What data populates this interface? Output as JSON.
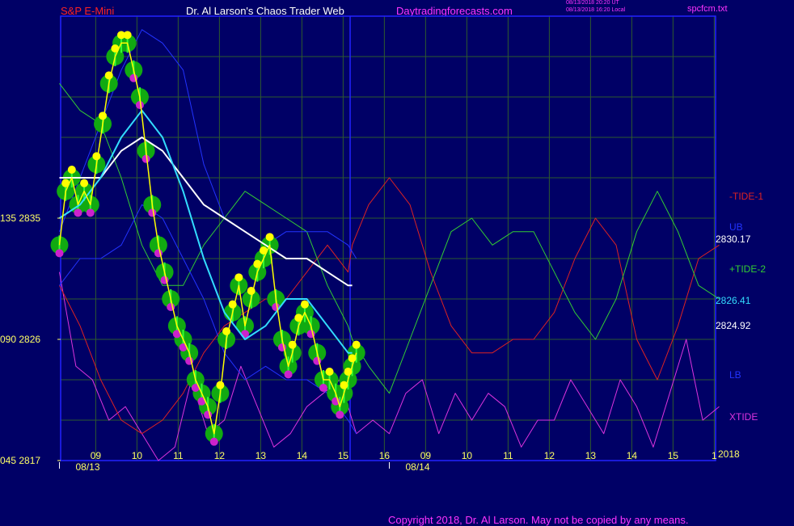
{
  "header": {
    "title": "S&P E-Mini",
    "web": "Dr. Al Larson's Chaos Trader Web",
    "url": "Daytradingforecasts.com",
    "timestamp_utc": "08/13/2018 20:20 UT",
    "timestamp_local": "08/13/2018 16:20 Local",
    "file": "spcfcm.txt"
  },
  "footer": {
    "copyright": "Copyright 2018, Dr. Al Larson. May not be copied by any means."
  },
  "colors": {
    "background": "#000066",
    "grid": "#2d5a2d",
    "frame": "#2222ff",
    "title": "#ff2222",
    "web": "#ffffff",
    "url": "#ff33ff",
    "tide1": "#dd2222",
    "tide2": "#33cc33",
    "xtide": "#dd33dd",
    "ub": "#2233ff",
    "lb": "#2233ff",
    "price": "#ffff00",
    "ma_fast": "#33ddff",
    "ma_slow": "#ffffff",
    "dot_yellow": "#ffff00",
    "dot_magenta": "#cc22cc",
    "halo": "#11aa11",
    "bars": "#33ff33"
  },
  "chart_data": {
    "type": "line",
    "title": "S&P E-Mini",
    "y_axis": {
      "ticks": [
        {
          "label": "135  2835",
          "value": 2835
        },
        {
          "label": "090  2826",
          "value": 2826
        },
        {
          "label": "045  2817",
          "value": 2817
        }
      ],
      "range": [
        2817,
        2850
      ]
    },
    "x_axis": {
      "hour_labels": [
        "09",
        "10",
        "11",
        "12",
        "13",
        "14",
        "15",
        "16",
        "09",
        "10",
        "11",
        "12",
        "13",
        "14",
        "15",
        "1"
      ],
      "date_labels": [
        "08/13",
        "08/14"
      ],
      "year": "2018"
    },
    "right_labels": [
      {
        "text": "-TIDE-1",
        "color": "#dd2222"
      },
      {
        "text": "UB",
        "color": "#2233ff"
      },
      {
        "text": "2830.17",
        "color": "#ffffff"
      },
      {
        "text": "+TIDE-2",
        "color": "#33cc33"
      },
      {
        "text": "2826.41",
        "color": "#33ddff"
      },
      {
        "text": "2824.92",
        "color": "#ffffff"
      },
      {
        "text": "LB",
        "color": "#2233ff"
      },
      {
        "text": "XTIDE",
        "color": "#dd33dd"
      }
    ],
    "series": [
      {
        "name": "-TIDE-1",
        "kind": "forecast",
        "x": [
          0,
          0.5,
          1,
          1.5,
          2,
          2.5,
          3,
          3.5,
          4,
          4.5,
          5,
          5.5,
          6,
          6.5,
          7,
          7.1,
          7.5,
          8,
          8.5,
          9,
          9.5,
          10,
          10.5,
          11,
          11.5,
          12,
          12.5,
          13,
          13.5,
          14,
          14.5,
          15,
          15.5,
          16
        ],
        "y": [
          2830,
          2827,
          2823,
          2820,
          2819,
          2820,
          2822,
          2825,
          2827,
          2828,
          2829,
          2829,
          2831,
          2833,
          2831,
          2833,
          2836,
          2838,
          2836,
          2831,
          2827,
          2825,
          2825,
          2826,
          2826,
          2828,
          2832,
          2835,
          2833,
          2826,
          2823,
          2827,
          2832,
          2833
        ]
      },
      {
        "name": "+TIDE-2",
        "kind": "forecast",
        "x": [
          0,
          0.5,
          1,
          1.5,
          2,
          2.5,
          3,
          3.5,
          4,
          4.5,
          5,
          5.5,
          6,
          6.5,
          7,
          7.1,
          7.5,
          8,
          8.5,
          9,
          9.5,
          10,
          10.5,
          11,
          11.5,
          12,
          12.5,
          13,
          13.5,
          14,
          14.5,
          15,
          15.5,
          16
        ],
        "y": [
          2845,
          2843,
          2842,
          2838,
          2833,
          2830,
          2830,
          2833,
          2835,
          2837,
          2836,
          2835,
          2834,
          2830,
          2827,
          2826,
          2824,
          2822,
          2826,
          2830,
          2834,
          2835,
          2833,
          2834,
          2834,
          2831,
          2828,
          2826,
          2829,
          2834,
          2837,
          2834,
          2830,
          2829
        ]
      },
      {
        "name": "XTIDE",
        "kind": "cycle",
        "x": [
          0,
          0.4,
          0.8,
          1.2,
          1.6,
          2,
          2.4,
          2.8,
          3.2,
          3.6,
          4,
          4.4,
          4.8,
          5.2,
          5.6,
          6,
          6.4,
          6.8,
          7.2,
          7.6,
          8,
          8.4,
          8.8,
          9.2,
          9.6,
          10,
          10.4,
          10.8,
          11.2,
          11.6,
          12,
          12.4,
          12.8,
          13.2,
          13.6,
          14,
          14.4,
          14.8,
          15.2,
          15.6,
          16
        ],
        "y": [
          2831,
          2824,
          2823,
          2820,
          2821,
          2819,
          2817,
          2818,
          2823,
          2819,
          2820,
          2824,
          2821,
          2818,
          2819,
          2821,
          2822,
          2823,
          2819,
          2820,
          2819,
          2822,
          2823,
          2819,
          2822,
          2820,
          2822,
          2821,
          2818,
          2820,
          2820,
          2823,
          2821,
          2819,
          2823,
          2821,
          2818,
          2822,
          2826,
          2820,
          2821
        ]
      },
      {
        "name": "UB",
        "kind": "band",
        "x": [
          0,
          0.5,
          1,
          1.5,
          2,
          2.5,
          3,
          3.5,
          4,
          4.5,
          5,
          5.5,
          6,
          6.5,
          7,
          7.2
        ],
        "y": [
          2834,
          2838,
          2842,
          2846,
          2849,
          2848,
          2846,
          2839,
          2835,
          2834,
          2833,
          2834,
          2834,
          2834,
          2833,
          2832
        ]
      },
      {
        "name": "LB",
        "kind": "band",
        "x": [
          0,
          0.5,
          1,
          1.5,
          2,
          2.5,
          3,
          3.5,
          4,
          4.5,
          5,
          5.5,
          6,
          6.5,
          7,
          7.2
        ],
        "y": [
          2830,
          2832,
          2832,
          2833,
          2836,
          2835,
          2832,
          2829,
          2825,
          2823,
          2824,
          2823,
          2823,
          2822,
          2820,
          2819
        ]
      },
      {
        "name": "price",
        "kind": "price",
        "x": [
          0,
          0.15,
          0.3,
          0.45,
          0.6,
          0.75,
          0.9,
          1.05,
          1.2,
          1.35,
          1.5,
          1.65,
          1.8,
          1.95,
          2.1,
          2.25,
          2.4,
          2.55,
          2.7,
          2.85,
          3,
          3.15,
          3.3,
          3.45,
          3.6,
          3.75,
          3.9,
          4.05,
          4.2,
          4.35,
          4.5,
          4.65,
          4.8,
          4.95,
          5.1,
          5.25,
          5.4,
          5.55,
          5.65,
          5.8,
          5.95,
          6.1,
          6.25,
          6.4,
          6.55,
          6.7,
          6.8,
          6.9,
          7,
          7.1,
          7.2
        ],
        "y": [
          2833,
          2837,
          2838,
          2836,
          2837,
          2836,
          2839,
          2842,
          2845,
          2847,
          2848,
          2848,
          2846,
          2844,
          2840,
          2836,
          2833,
          2831,
          2829,
          2827,
          2826,
          2825,
          2823,
          2822,
          2821,
          2819,
          2822,
          2826,
          2828,
          2830,
          2827,
          2829,
          2831,
          2832,
          2833,
          2829,
          2826,
          2824,
          2825,
          2827,
          2828,
          2827,
          2825,
          2823,
          2823,
          2822,
          2821,
          2822,
          2823,
          2824,
          2825
        ]
      },
      {
        "name": "MA-fast",
        "kind": "ma",
        "x": [
          0,
          0.5,
          1,
          1.5,
          2,
          2.5,
          3,
          3.5,
          4,
          4.5,
          5,
          5.5,
          6,
          6.5,
          7,
          7.1
        ],
        "y": [
          2835,
          2836,
          2838,
          2841,
          2843,
          2841,
          2837,
          2832,
          2828,
          2826,
          2827,
          2829,
          2829,
          2827,
          2825,
          2825
        ]
      },
      {
        "name": "MA-slow",
        "kind": "ma",
        "x": [
          0,
          0.5,
          1,
          1.5,
          2,
          2.5,
          3,
          3.5,
          4,
          4.5,
          5,
          5.5,
          6,
          6.5,
          7,
          7.1
        ],
        "y": [
          2838,
          2838,
          2838,
          2840,
          2841,
          2840,
          2838,
          2836,
          2835,
          2834,
          2833,
          2832,
          2832,
          2831,
          2830,
          2830
        ]
      }
    ]
  }
}
